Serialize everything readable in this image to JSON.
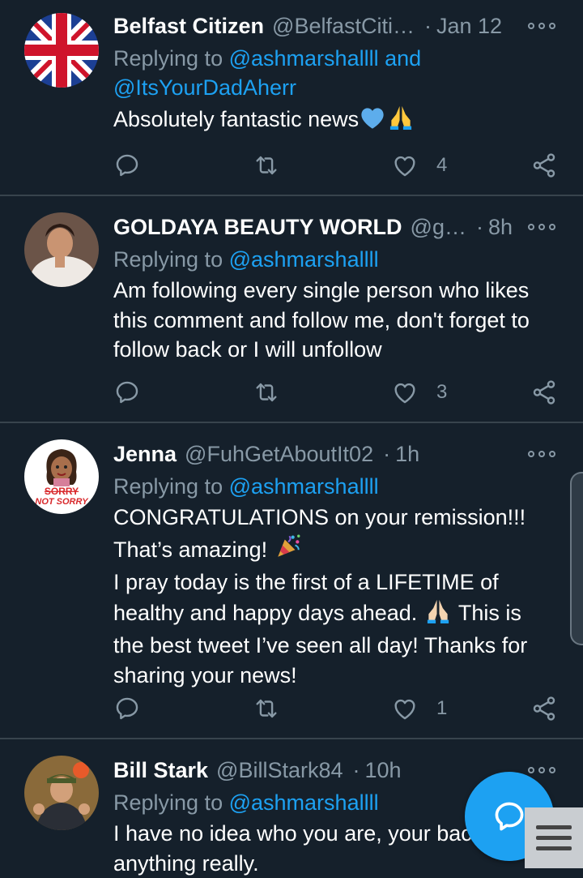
{
  "tweets": [
    {
      "name": "Belfast Citizen",
      "handle": "@BelfastCiti…",
      "time": "Jan 12",
      "replying_prefix": "Replying to",
      "replying_to_line1": "@ashmarshallll and",
      "replying_to_line2": "@ItsYourDadAherr",
      "text_lines": [
        "Absolutely fantastic news"
      ],
      "emojis": [
        "blue-heart",
        "folded-hands"
      ],
      "likes": "4"
    },
    {
      "name": "GOLDAYA BEAUTY WORLD",
      "handle": "@g…",
      "time": "8h",
      "replying_prefix": "Replying to",
      "replying_to": "@ashmarshallll",
      "text_lines": [
        "Am following every single person who likes",
        "this comment and follow me, don't forget to",
        "follow back or I will unfollow"
      ],
      "likes": "3"
    },
    {
      "name": "Jenna",
      "handle": "@FuhGetAboutIt02",
      "time": "1h",
      "replying_prefix": "Replying to",
      "replying_to": "@ashmarshallll",
      "text_lines": [
        "CONGRATULATIONS on your remission!!!",
        "That’s amazing!",
        "I pray today is the first of a LIFETIME of",
        "healthy and happy days ahead.",
        "This is",
        "the best tweet I’ve seen all day! Thanks for",
        "sharing your news!"
      ],
      "avatar_text": [
        "SORRY",
        "NOT SORRY"
      ],
      "likes": "1"
    },
    {
      "name": "Bill Stark",
      "handle": "@BillStark84",
      "time": "10h",
      "replying_prefix": "Replying to",
      "replying_to": "@ashmarshallll",
      "text_lines": [
        "I have no idea who you are, your bac",
        "anything really."
      ]
    }
  ],
  "separator": "·",
  "icons": {
    "reply": "reply-icon",
    "retweet": "retweet-icon",
    "like": "heart-icon",
    "share": "share-icon",
    "compose": "compose-reply-icon",
    "menu": "menu-icon"
  },
  "colors": {
    "background": "#15202b",
    "accent": "#1da1f2",
    "muted": "#8899a6",
    "divider": "#38444d"
  }
}
